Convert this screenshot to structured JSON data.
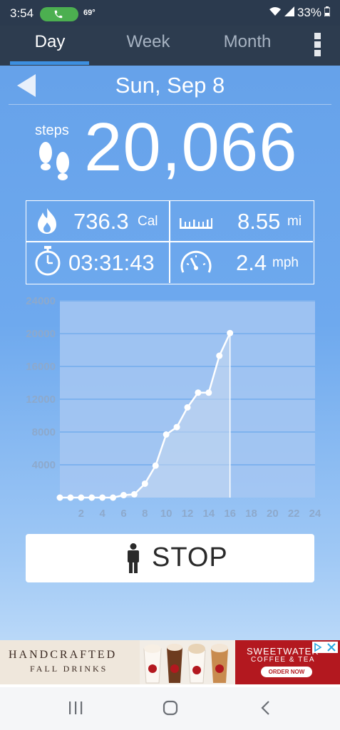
{
  "status_bar": {
    "time": "3:54",
    "temperature": "69°",
    "battery": "33%",
    "icons": [
      "phone-call-icon",
      "wifi-icon",
      "signal-icon",
      "battery-icon"
    ]
  },
  "tabs": [
    {
      "label": "Day",
      "active": true
    },
    {
      "label": "Week",
      "active": false
    },
    {
      "label": "Month",
      "active": false
    }
  ],
  "header": {
    "date": "Sun, Sep 8"
  },
  "steps": {
    "label": "steps",
    "value": "20,066"
  },
  "stats": {
    "calories": {
      "value": "736.3",
      "unit": "Cal",
      "icon": "flame-icon"
    },
    "distance": {
      "value": "8.55",
      "unit": "mi",
      "icon": "ruler-icon"
    },
    "duration": {
      "value": "03:31:43",
      "icon": "stopwatch-icon"
    },
    "speed": {
      "value": "2.4",
      "unit": "mph",
      "icon": "speedometer-icon"
    }
  },
  "chart_data": {
    "type": "area",
    "x_ticks": [
      "2",
      "4",
      "6",
      "8",
      "10",
      "12",
      "14",
      "16",
      "18",
      "20",
      "22",
      "24"
    ],
    "y_ticks": [
      "24000",
      "20000",
      "16000",
      "12000",
      "8000",
      "4000"
    ],
    "xlim": [
      0,
      24
    ],
    "ylim": [
      0,
      24000
    ],
    "x": [
      0,
      1,
      2,
      3,
      4,
      5,
      6,
      7,
      8,
      9,
      10,
      11,
      12,
      13,
      14,
      15,
      16
    ],
    "y": [
      0,
      0,
      0,
      0,
      0,
      0,
      300,
      400,
      1700,
      3900,
      7700,
      8600,
      11000,
      12800,
      12800,
      17300,
      20066
    ],
    "grid": true,
    "colors": {
      "line": "#ffffff",
      "grid": "#7eb2ee",
      "plot_bg": "#a6c7f2",
      "axis_text": "#8da9cc"
    }
  },
  "stop_button": {
    "label": "STOP",
    "icon": "person-icon"
  },
  "ad": {
    "headline_1": "HANDCRAFTED",
    "headline_2": "FALL DRINKS",
    "brand_1": "SWEETWATER",
    "brand_2": "COFFEE & TEA",
    "cta": "ORDER NOW"
  },
  "nav_bar": {
    "buttons": [
      "recents-icon",
      "home-icon",
      "back-icon"
    ]
  }
}
